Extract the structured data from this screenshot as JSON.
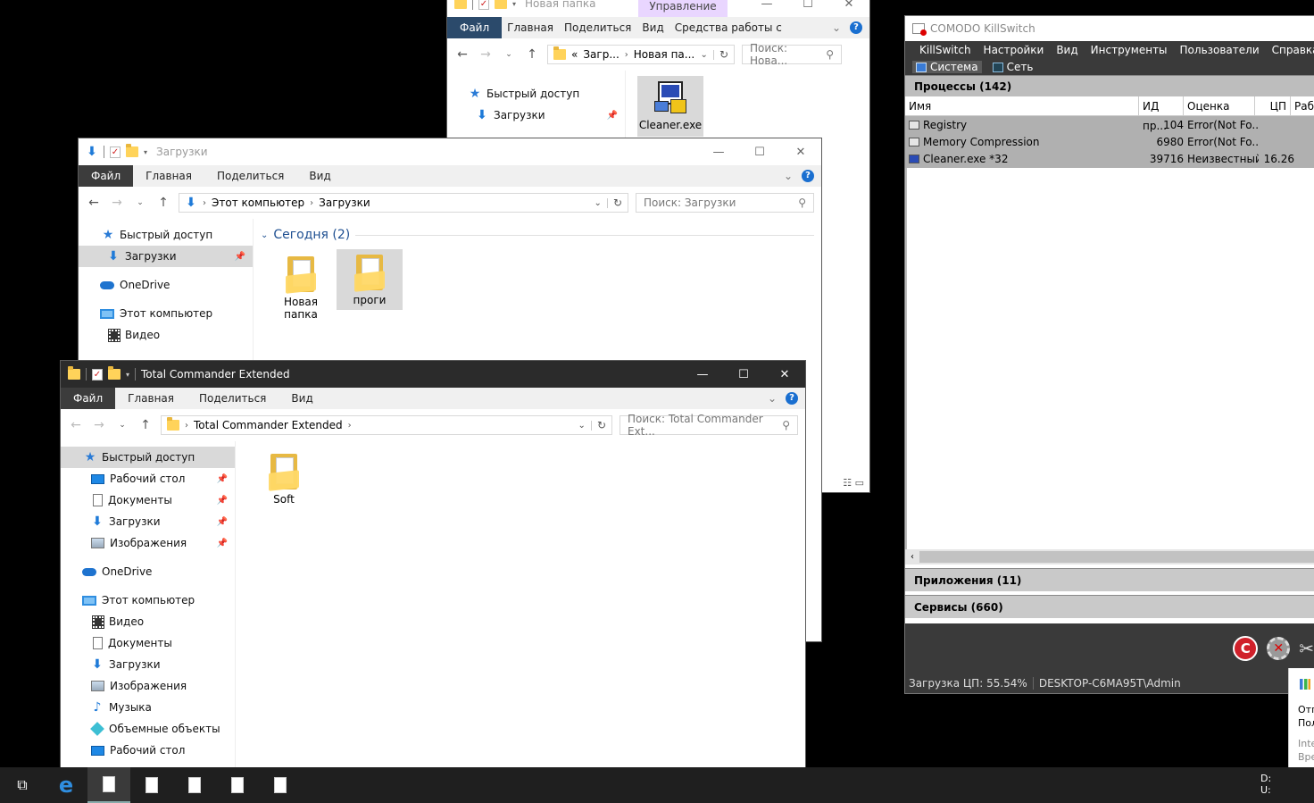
{
  "win_back": {
    "title": "Новая папка",
    "manage_tab": "Управление",
    "tabs": [
      "Файл",
      "Главная",
      "Поделиться",
      "Вид",
      "Средства работы с приложениями"
    ],
    "path": [
      "«",
      "Загр...",
      "Новая па..."
    ],
    "search_placeholder": "Поиск: Нова...",
    "side": [
      "Быстрый доступ",
      "Загрузки"
    ],
    "file_label": "Cleaner.exe"
  },
  "win_downloads": {
    "title": "Загрузки",
    "tabs": [
      "Файл",
      "Главная",
      "Поделиться",
      "Вид"
    ],
    "path": [
      "Этот компьютер",
      "Загрузки"
    ],
    "search_placeholder": "Поиск: Загрузки",
    "side": [
      "Быстрый доступ",
      "Загрузки",
      "OneDrive",
      "Этот компьютер",
      "Видео"
    ],
    "group_header": "Сегодня (2)",
    "files": [
      "Новая папка",
      "проги"
    ]
  },
  "win_tc": {
    "title": "Total Commander Extended",
    "tabs": [
      "Файл",
      "Главная",
      "Поделиться",
      "Вид"
    ],
    "path": [
      "Total Commander Extended"
    ],
    "search_placeholder": "Поиск: Total Commander Ext...",
    "side": [
      "Быстрый доступ",
      "Рабочий стол",
      "Документы",
      "Загрузки",
      "Изображения",
      "OneDrive",
      "Этот компьютер",
      "Видео",
      "Документы",
      "Загрузки",
      "Изображения",
      "Музыка",
      "Объемные объекты",
      "Рабочий стол"
    ],
    "files": [
      "Soft"
    ]
  },
  "comodo": {
    "title": "COMODO KillSwitch",
    "menu": [
      "KillSwitch",
      "Настройки",
      "Вид",
      "Инструменты",
      "Пользователи",
      "Справка"
    ],
    "tabs": [
      "Система",
      "Сеть"
    ],
    "processes_header": "Процессы (142)",
    "columns": [
      "Имя",
      "ИД пр...",
      "Оценка",
      "ЦП",
      "Рабо"
    ],
    "rows": [
      {
        "name": "Registry",
        "pid": "104",
        "rating": "Error(Not Fo...",
        "cpu": ""
      },
      {
        "name": "Memory Compression",
        "pid": "6980",
        "rating": "Error(Not Fo...",
        "cpu": ""
      },
      {
        "name": "Cleaner.exe *32",
        "pid": "39716",
        "rating": "Неизвестный",
        "cpu": "16.26"
      }
    ],
    "apps_header": "Приложения (11)",
    "services_header": "Сервисы (660)",
    "status_cpu": "Загрузка ЦП: 55.54%",
    "status_user": "DESKTOP-C6MA95T\\Admin"
  },
  "notif": {
    "l1": "Отг",
    "l2": "Пол",
    "l3": "Inte",
    "l4": "Вре"
  },
  "tray": {
    "d": "D:",
    "u": "U:"
  }
}
